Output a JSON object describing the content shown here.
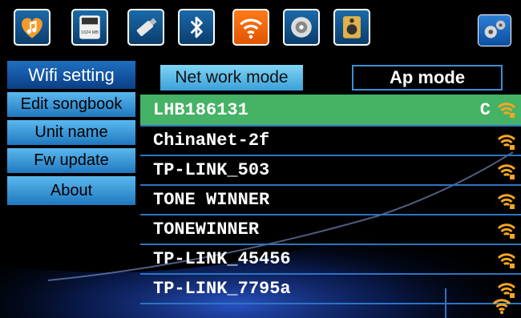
{
  "topbar": {
    "icons": [
      {
        "name": "music-icon"
      },
      {
        "name": "sd-card-icon",
        "label": "1024 MB"
      },
      {
        "name": "usb-icon"
      },
      {
        "name": "bluetooth-icon"
      },
      {
        "name": "wifi-icon"
      },
      {
        "name": "disc-icon"
      },
      {
        "name": "speaker-icon"
      },
      {
        "name": "settings-icon"
      }
    ],
    "sd_label": "1024 MB"
  },
  "sidebar": {
    "items": [
      {
        "label": "Wifi setting",
        "active": true
      },
      {
        "label": "Edit songbook"
      },
      {
        "label": "Unit name"
      },
      {
        "label": "Fw update"
      },
      {
        "label": "About"
      }
    ]
  },
  "modes": {
    "network": "Net work mode",
    "ap": "Ap mode"
  },
  "networks": [
    {
      "ssid": "LHB186131",
      "tag": "C",
      "selected": true
    },
    {
      "ssid": "ChinaNet-2f"
    },
    {
      "ssid": "TP-LINK_503"
    },
    {
      "ssid": "TONE WINNER"
    },
    {
      "ssid": "TONEWINNER"
    },
    {
      "ssid": "TP-LINK_45456"
    },
    {
      "ssid": "TP-LINK_7795a"
    }
  ],
  "colors": {
    "accent_blue": "#2c74c4",
    "selected_green": "#46b265",
    "wifi_orange": "#f5a623"
  }
}
